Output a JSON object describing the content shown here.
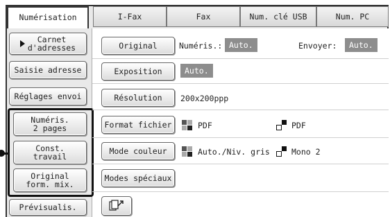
{
  "tabs": [
    {
      "label": "Numérisation",
      "active": true
    },
    {
      "label": "I-Fax",
      "active": false
    },
    {
      "label": "Fax",
      "active": false
    },
    {
      "label": "Num. clé USB",
      "active": false
    },
    {
      "label": "Num. PC",
      "active": false
    }
  ],
  "left": {
    "address_book": "Carnet\nd'adresses",
    "address_entry": "Saisie adresse",
    "send_settings": "Réglages envoi",
    "scan_2pages": "Numéris.\n2 pages",
    "job_build": "Const.\ntravail",
    "mixed_original": "Original\nform. mix.",
    "preview": "Prévisualis."
  },
  "rows": {
    "original": {
      "button": "Original",
      "scan_label": "Numéris.:",
      "scan_value": "Auto.",
      "send_label": "Envoyer:",
      "send_value": "Auto."
    },
    "exposure": {
      "button": "Exposition",
      "value": "Auto."
    },
    "resolution": {
      "button": "Résolution",
      "value": "200x200ppp"
    },
    "file_format": {
      "button": "Format fichier",
      "color_value": "PDF",
      "bw_value": "PDF"
    },
    "color_mode": {
      "button": "Mode couleur",
      "color_value": "Auto./Niv. gris",
      "bw_value": "Mono 2"
    },
    "special_modes": {
      "button": "Modes spéciaux"
    }
  },
  "icons": {
    "arrow": "play-triangle",
    "color": "color-grid-icon",
    "bw": "bw-corner-icon",
    "send_cut": "send-cut-icon"
  },
  "colors": {
    "shade": "#8d8d8d",
    "frame": "#333333"
  }
}
